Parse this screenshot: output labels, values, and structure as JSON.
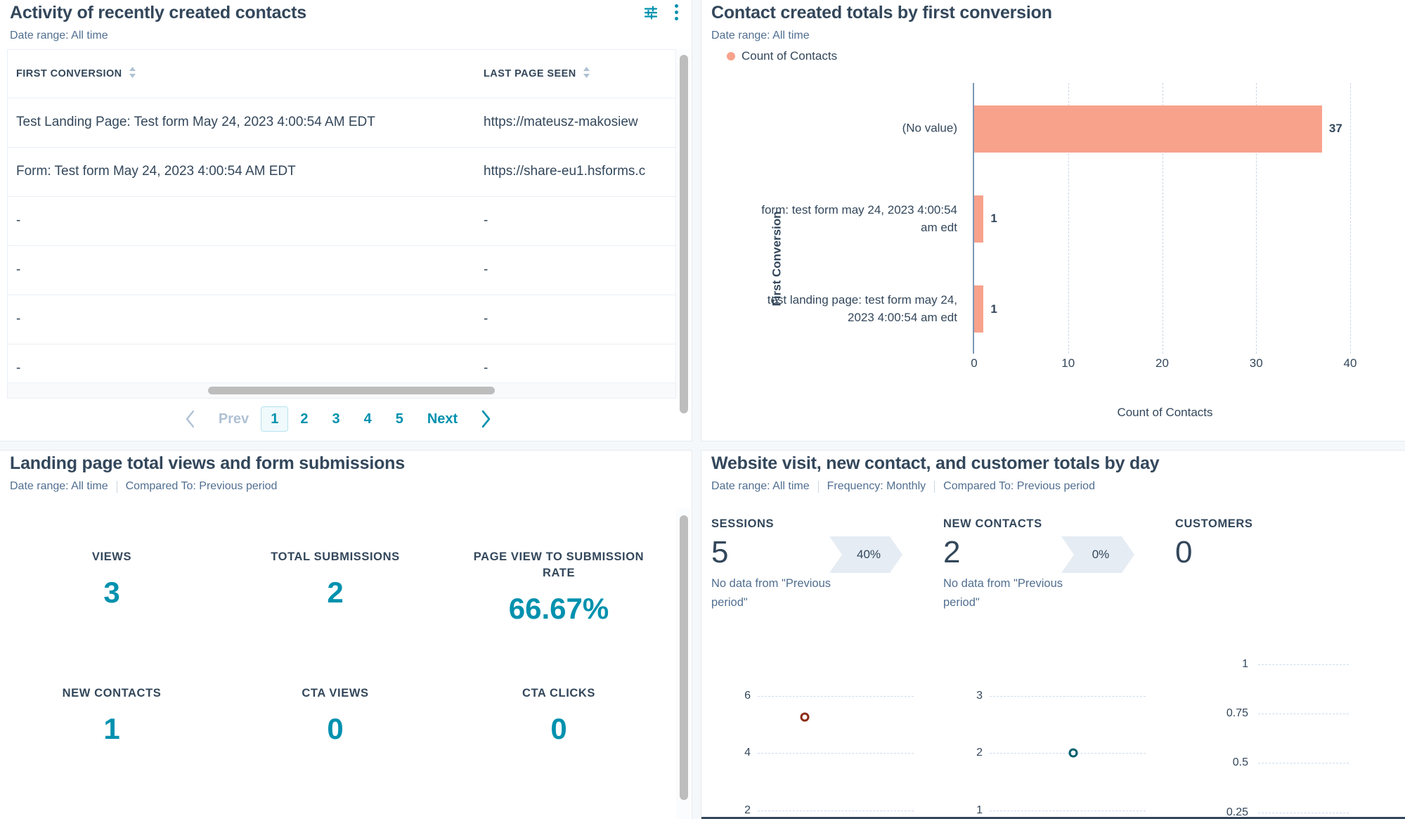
{
  "panel_activity": {
    "title": "Activity of recently created contacts",
    "date_range": "Date range: All time",
    "filter_icon": "sliders-icon",
    "menu_icon": "kebab-menu-icon",
    "table": {
      "columns": [
        "FIRST CONVERSION",
        "LAST PAGE SEEN"
      ],
      "rows": [
        [
          "Test Landing Page: Test form May 24, 2023 4:00:54 AM EDT",
          "https://mateusz-makosiew"
        ],
        [
          "Form: Test form May 24, 2023 4:00:54 AM EDT",
          "https://share-eu1.hsforms.c"
        ],
        [
          "-",
          "-"
        ],
        [
          "-",
          "-"
        ],
        [
          "-",
          "-"
        ],
        [
          "-",
          "-"
        ]
      ]
    },
    "pagination": {
      "prev": "Prev",
      "pages": [
        "1",
        "2",
        "3",
        "4",
        "5"
      ],
      "current_page": "1",
      "next": "Next"
    }
  },
  "panel_conversion": {
    "title": "Contact created totals by first conversion",
    "date_range": "Date range: All time",
    "legend": "Count of Contacts",
    "chart_data": {
      "type": "bar",
      "orientation": "horizontal",
      "title": "Contact created totals by first conversion",
      "ylabel": "First Conversion",
      "xlabel": "Count of Contacts",
      "categories": [
        "(No value)",
        "form: test form may 24, 2023 4:00:54 am edt",
        "test landing page: test form may 24, 2023 4:00:54 am edt"
      ],
      "values": [
        37,
        1,
        1
      ],
      "series": [
        {
          "name": "Count of Contacts",
          "values": [
            37,
            1,
            1
          ]
        }
      ],
      "xlim": [
        0,
        40
      ],
      "xticks": [
        "0",
        "10",
        "20",
        "30",
        "40"
      ],
      "grid": true,
      "legend_position": "top-left",
      "bar_color": "#f8a28c"
    }
  },
  "panel_landing": {
    "title": "Landing page total views and form submissions",
    "date_range": "Date range: All time",
    "compared_to": "Compared To: Previous period",
    "metrics": [
      {
        "label": "VIEWS",
        "value": "3"
      },
      {
        "label": "TOTAL SUBMISSIONS",
        "value": "2"
      },
      {
        "label": "PAGE VIEW TO SUBMISSION RATE",
        "value": "66.67%"
      },
      {
        "label": "NEW CONTACTS",
        "value": "1"
      },
      {
        "label": "CTA VIEWS",
        "value": "0"
      },
      {
        "label": "CTA CLICKS",
        "value": "0"
      }
    ]
  },
  "panel_website": {
    "title": "Website visit, new contact, and customer totals by day",
    "date_range": "Date range: All time",
    "frequency": "Frequency: Monthly",
    "compared_to": "Compared To: Previous period",
    "comparisons": [
      {
        "label": "SESSIONS",
        "value": "5",
        "sub": "No data from \"Previous period\"",
        "badge": "40%"
      },
      {
        "label": "NEW CONTACTS",
        "value": "2",
        "sub": "No data from \"Previous period\"",
        "badge": "0%"
      },
      {
        "label": "CUSTOMERS",
        "value": "0",
        "sub": "",
        "badge": ""
      }
    ],
    "mini_charts": [
      {
        "type": "scatter",
        "name": "Sessions",
        "yticks": [
          "6",
          "4",
          "2"
        ],
        "values": [
          5
        ],
        "point_color": "#8b2d17"
      },
      {
        "type": "scatter",
        "name": "New contacts",
        "yticks": [
          "3",
          "2",
          "1"
        ],
        "values": [
          2
        ],
        "point_color": "#00616e"
      },
      {
        "type": "scatter",
        "name": "Customers",
        "yticks": [
          "1",
          "0.75",
          "0.5",
          "0.25"
        ],
        "values": [],
        "point_color": "#00616e"
      }
    ]
  },
  "colors": {
    "accent_teal": "#0091ae",
    "bar_orange": "#f8a28c",
    "text_dark": "#33475b",
    "text_muted": "#516f90"
  }
}
